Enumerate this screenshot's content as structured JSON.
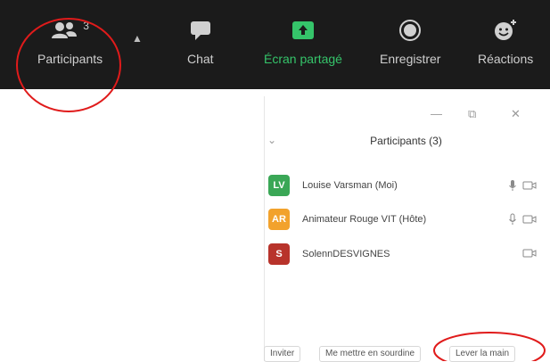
{
  "toolbar": {
    "participants_label": "Participants",
    "participants_count": "3",
    "chat_label": "Chat",
    "share_label": "Écran partagé",
    "record_label": "Enregistrer",
    "reactions_label": "Réactions"
  },
  "panel": {
    "title": "Participants (3)",
    "participants": [
      {
        "initials": "LV",
        "name": "Louise Varsman (Moi)",
        "color": "#3aa756"
      },
      {
        "initials": "AR",
        "name": "Animateur Rouge VIT (Hôte)",
        "color": "#f2a22c"
      },
      {
        "initials": "S",
        "name": "SolennDESVIGNES",
        "color": "#b8332b"
      }
    ],
    "buttons": {
      "invite": "Inviter",
      "mute_self": "Me mettre en sourdine",
      "raise_hand": "Lever la main"
    }
  },
  "colors": {
    "toolbar_bg": "#1b1b1b",
    "share_green": "#35c46a",
    "annotation_red": "#e01b1b"
  }
}
